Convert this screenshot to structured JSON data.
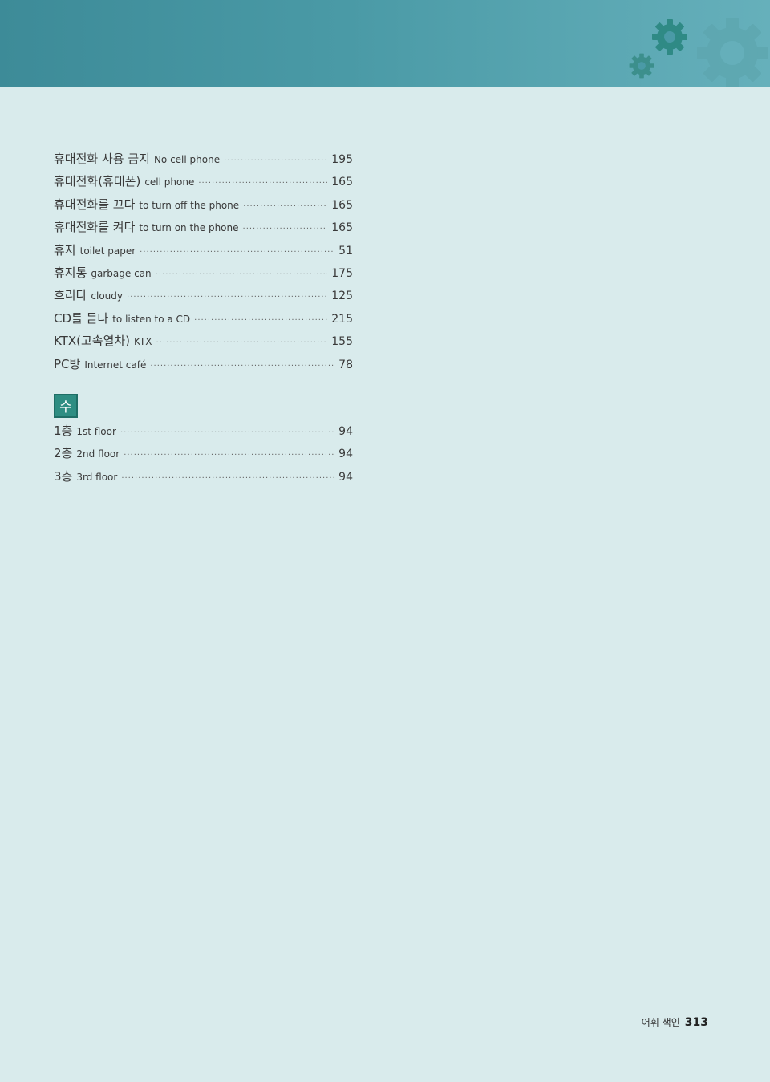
{
  "entries_1": [
    {
      "ko": "휴대전화 사용 금지",
      "en": "No cell phone",
      "page": "195"
    },
    {
      "ko": "휴대전화(휴대폰)",
      "en": "cell phone",
      "page": "165"
    },
    {
      "ko": "휴대전화를 끄다",
      "en": "to turn off the phone",
      "page": "165"
    },
    {
      "ko": "휴대전화를 켜다",
      "en": "to turn on the phone",
      "page": "165"
    },
    {
      "ko": "휴지",
      "en": "toilet paper",
      "page": "51"
    },
    {
      "ko": "휴지통",
      "en": "garbage can",
      "page": "175"
    },
    {
      "ko": "흐리다",
      "en": "cloudy",
      "page": "125"
    },
    {
      "ko": "CD를 듣다",
      "en": "to listen to a CD",
      "page": "215"
    },
    {
      "ko": "KTX(고속열차)",
      "en": "KTX",
      "page": "155"
    },
    {
      "ko": "PC방",
      "en": "Internet café",
      "page": "78"
    }
  ],
  "section_badge": "수",
  "entries_2": [
    {
      "ko": "1층",
      "en": "1st floor",
      "page": "94"
    },
    {
      "ko": "2층",
      "en": "2nd floor",
      "page": "94"
    },
    {
      "ko": "3층",
      "en": "3rd floor",
      "page": "94"
    }
  ],
  "footer": {
    "label": "어휘 색인",
    "page_number": "313"
  },
  "colors": {
    "background": "#d9ebec",
    "header_band": "#4a9aa6",
    "badge": "#2e8d82"
  }
}
